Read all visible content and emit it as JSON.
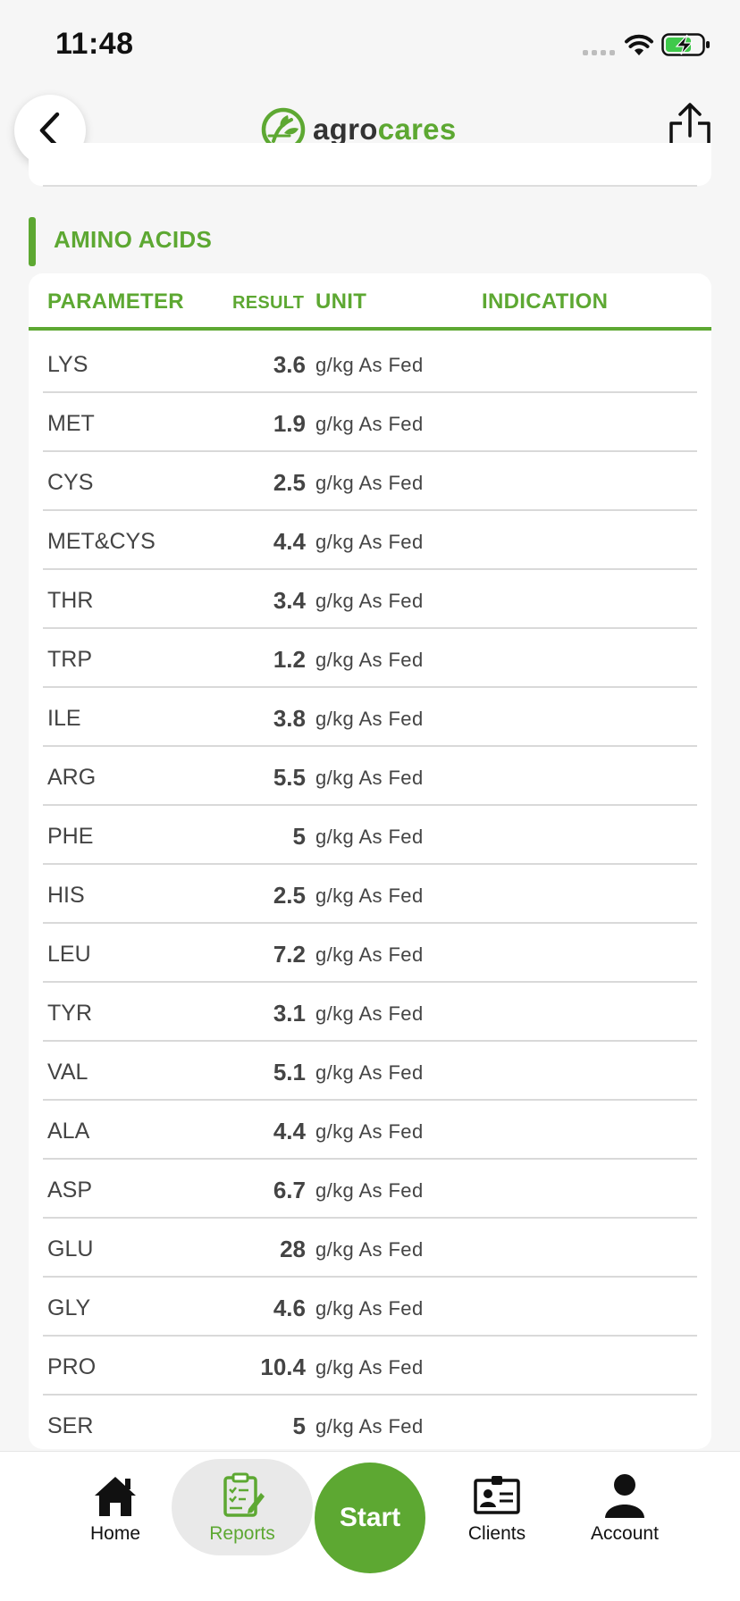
{
  "status": {
    "time": "11:48"
  },
  "header": {
    "logo_text_a": "agro",
    "logo_text_b": "cares",
    "back_icon": "chevron-left-icon",
    "share_icon": "share-icon"
  },
  "section": {
    "title": "AMINO ACIDS"
  },
  "table": {
    "headers": {
      "parameter": "PARAMETER",
      "result": "RESULT",
      "unit": "UNIT",
      "indication": "INDICATION"
    },
    "rows": [
      {
        "parameter": "LYS",
        "result": "3.6",
        "unit": "g/kg As Fed",
        "indication": ""
      },
      {
        "parameter": "MET",
        "result": "1.9",
        "unit": "g/kg As Fed",
        "indication": ""
      },
      {
        "parameter": "CYS",
        "result": "2.5",
        "unit": "g/kg As Fed",
        "indication": ""
      },
      {
        "parameter": "MET&CYS",
        "result": "4.4",
        "unit": "g/kg As Fed",
        "indication": ""
      },
      {
        "parameter": "THR",
        "result": "3.4",
        "unit": "g/kg As Fed",
        "indication": ""
      },
      {
        "parameter": "TRP",
        "result": "1.2",
        "unit": "g/kg As Fed",
        "indication": ""
      },
      {
        "parameter": "ILE",
        "result": "3.8",
        "unit": "g/kg As Fed",
        "indication": ""
      },
      {
        "parameter": "ARG",
        "result": "5.5",
        "unit": "g/kg As Fed",
        "indication": ""
      },
      {
        "parameter": "PHE",
        "result": "5",
        "unit": "g/kg As Fed",
        "indication": ""
      },
      {
        "parameter": "HIS",
        "result": "2.5",
        "unit": "g/kg As Fed",
        "indication": ""
      },
      {
        "parameter": "LEU",
        "result": "7.2",
        "unit": "g/kg As Fed",
        "indication": ""
      },
      {
        "parameter": "TYR",
        "result": "3.1",
        "unit": "g/kg As Fed",
        "indication": ""
      },
      {
        "parameter": "VAL",
        "result": "5.1",
        "unit": "g/kg As Fed",
        "indication": ""
      },
      {
        "parameter": "ALA",
        "result": "4.4",
        "unit": "g/kg As Fed",
        "indication": ""
      },
      {
        "parameter": "ASP",
        "result": "6.7",
        "unit": "g/kg As Fed",
        "indication": ""
      },
      {
        "parameter": "GLU",
        "result": "28",
        "unit": "g/kg As Fed",
        "indication": ""
      },
      {
        "parameter": "GLY",
        "result": "4.6",
        "unit": "g/kg As Fed",
        "indication": ""
      },
      {
        "parameter": "PRO",
        "result": "10.4",
        "unit": "g/kg As Fed",
        "indication": ""
      },
      {
        "parameter": "SER",
        "result": "5",
        "unit": "g/kg As Fed",
        "indication": ""
      }
    ]
  },
  "tabbar": {
    "home": "Home",
    "reports": "Reports",
    "start": "Start",
    "clients": "Clients",
    "account": "Account",
    "active": "Reports"
  },
  "colors": {
    "brand_green": "#5da832",
    "text": "#444444",
    "background": "#f6f6f6"
  }
}
